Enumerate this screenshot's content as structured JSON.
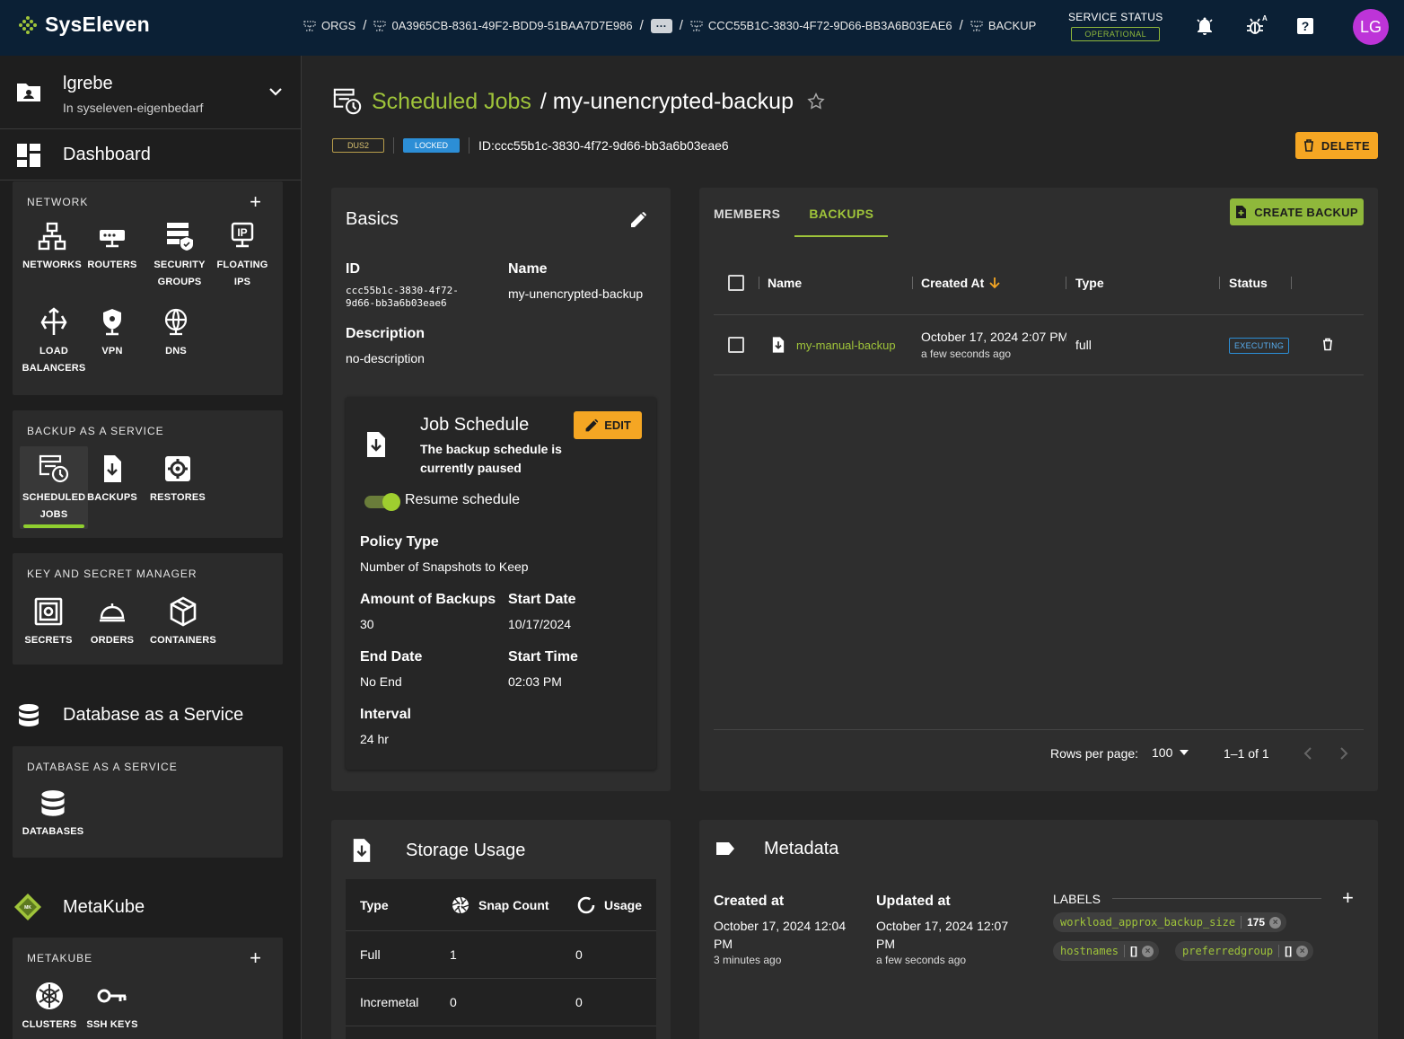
{
  "app": {
    "name": "SysEleven"
  },
  "breadcrumb": [
    {
      "label": "ORGS"
    },
    {
      "label": "0A3965CB-8361-49F2-BDD9-51BAA7D7E986"
    },
    {
      "label": "···"
    },
    {
      "label": "CCC55B1C-3830-4F72-9D66-BB3A6B03EAE6"
    },
    {
      "label": "BACKUP"
    }
  ],
  "service_status": {
    "label": "SERVICE STATUS",
    "value": "OPERATIONAL",
    "color": "#8fb83b"
  },
  "user": {
    "initials": "LG",
    "name": "lgrebe",
    "org": "In syseleven-eigenbedarf",
    "avatar_color": "#bd34d8"
  },
  "sidebar": {
    "dashboard": "Dashboard",
    "network": {
      "title": "NETWORK",
      "items": [
        "NETWORKS",
        "ROUTERS",
        "SECURITY GROUPS",
        "FLOATING IPS",
        "LOAD BALANCERS",
        "VPN",
        "DNS"
      ]
    },
    "backup": {
      "title": "BACKUP AS A SERVICE",
      "items": [
        "SCHEDULED JOBS",
        "BACKUPS",
        "RESTORES"
      ]
    },
    "kms": {
      "title": "KEY AND SECRET MANAGER",
      "items": [
        "SECRETS",
        "ORDERS",
        "CONTAINERS"
      ]
    },
    "dbaas_heading": "Database as a Service",
    "dbaas": {
      "title": "DATABASE AS A SERVICE",
      "items": [
        "DATABASES"
      ]
    },
    "metakube_heading": "MetaKube",
    "metakube": {
      "title": "METAKUBE",
      "items": [
        "CLUSTERS",
        "SSH KEYS"
      ]
    }
  },
  "page": {
    "section_link": "Scheduled Jobs",
    "name": "/ my-unencrypted-backup",
    "region_tag": "DUS2",
    "lock_tag": "LOCKED",
    "id_text": "ID:ccc55b1c-3830-4f72-9d66-bb3a6b03eae6",
    "delete_label": "DELETE"
  },
  "basics": {
    "title": "Basics",
    "id_label": "ID",
    "id_value": "ccc55b1c-3830-4f72-9d66-bb3a6b03eae6",
    "name_label": "Name",
    "name_value": "my-unencrypted-backup",
    "desc_label": "Description",
    "desc_value": "no-description"
  },
  "job_schedule": {
    "title": "Job Schedule",
    "subtitle": "The backup schedule is currently paused",
    "edit_label": "EDIT",
    "toggle_label": "Resume schedule",
    "policy_label": "Policy Type",
    "policy_value": "Number of Snapshots to Keep",
    "amount_label": "Amount of Backups",
    "amount_value": "30",
    "start_date_label": "Start Date",
    "start_date_value": "10/17/2024",
    "end_date_label": "End Date",
    "end_date_value": "No End",
    "start_time_label": "Start Time",
    "start_time_value": "02:03 PM",
    "interval_label": "Interval",
    "interval_value": "24 hr"
  },
  "backups_panel": {
    "tabs": [
      "MEMBERS",
      "BACKUPS"
    ],
    "active_tab": "BACKUPS",
    "create_label": "CREATE BACKUP",
    "columns": [
      "Name",
      "Created At",
      "Type",
      "Status"
    ],
    "rows": [
      {
        "name": "my-manual-backup",
        "created": "October 17, 2024 2:07 PM",
        "created_rel": "a few seconds ago",
        "type": "full",
        "status": "EXECUTING"
      }
    ],
    "rows_per_page_label": "Rows per page:",
    "rows_per_page": "100",
    "range": "1–1 of 1"
  },
  "storage": {
    "title": "Storage Usage",
    "columns": [
      "Type",
      "Snap Count",
      "Usage"
    ],
    "rows": [
      {
        "type": "Full",
        "count": "1",
        "usage": "0"
      },
      {
        "type": "Incremetal",
        "count": "0",
        "usage": "0"
      }
    ]
  },
  "metadata": {
    "title": "Metadata",
    "created_label": "Created at",
    "created_value": "October 17, 2024 12:04 PM",
    "created_rel": "3 minutes ago",
    "updated_label": "Updated at",
    "updated_value": "October 17, 2024 12:07 PM",
    "updated_rel": "a few seconds ago",
    "labels_title": "LABELS",
    "labels": [
      {
        "key": "workload_approx_backup_size",
        "value": "175"
      },
      {
        "key": "hostnames",
        "value": "[]"
      },
      {
        "key": "preferredgroup",
        "value": "[]"
      }
    ]
  }
}
